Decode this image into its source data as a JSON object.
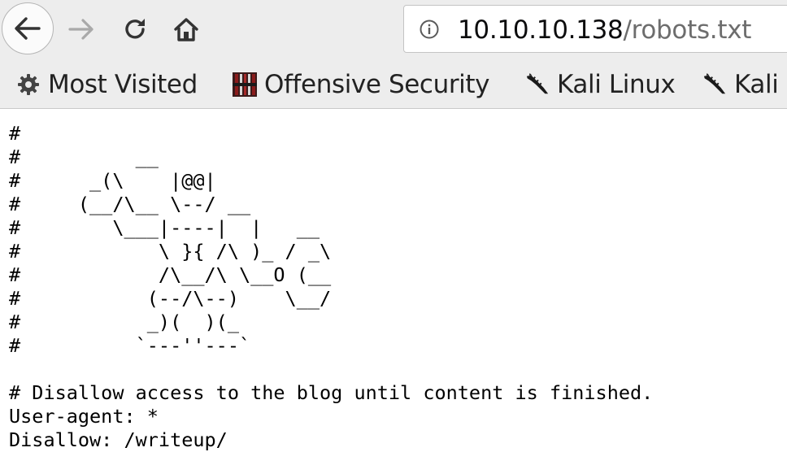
{
  "browser": {
    "url_host": "10.10.10.138",
    "url_path": "/robots.txt",
    "icons": {
      "back": "back-arrow-icon",
      "forward": "forward-arrow-icon",
      "reload": "reload-icon",
      "home": "home-icon",
      "site_info": "info-icon"
    }
  },
  "bookmarks": [
    {
      "label": "Most Visited",
      "icon": "gear-icon"
    },
    {
      "label": "Offensive Security",
      "icon": "offsec-logo-icon"
    },
    {
      "label": "Kali Linux",
      "icon": "kali-dragon-icon"
    },
    {
      "label": "Kali",
      "icon": "kali-dragon-icon"
    }
  ],
  "page": {
    "robots_txt": "#\n#          __\n#      _(\\    |@@|\n#     (__/\\__ \\--/ __\n#        \\___|----|  |   __\n#            \\ }{ /\\ )_ / _\\\n#            /\\__/\\ \\__O (__\n#           (--/\\--)    \\__/\n#           _)(  )(_\n#          `---''---`\n\n# Disallow access to the blog until content is finished.\nUser-agent: *\nDisallow: /writeup/"
  }
}
